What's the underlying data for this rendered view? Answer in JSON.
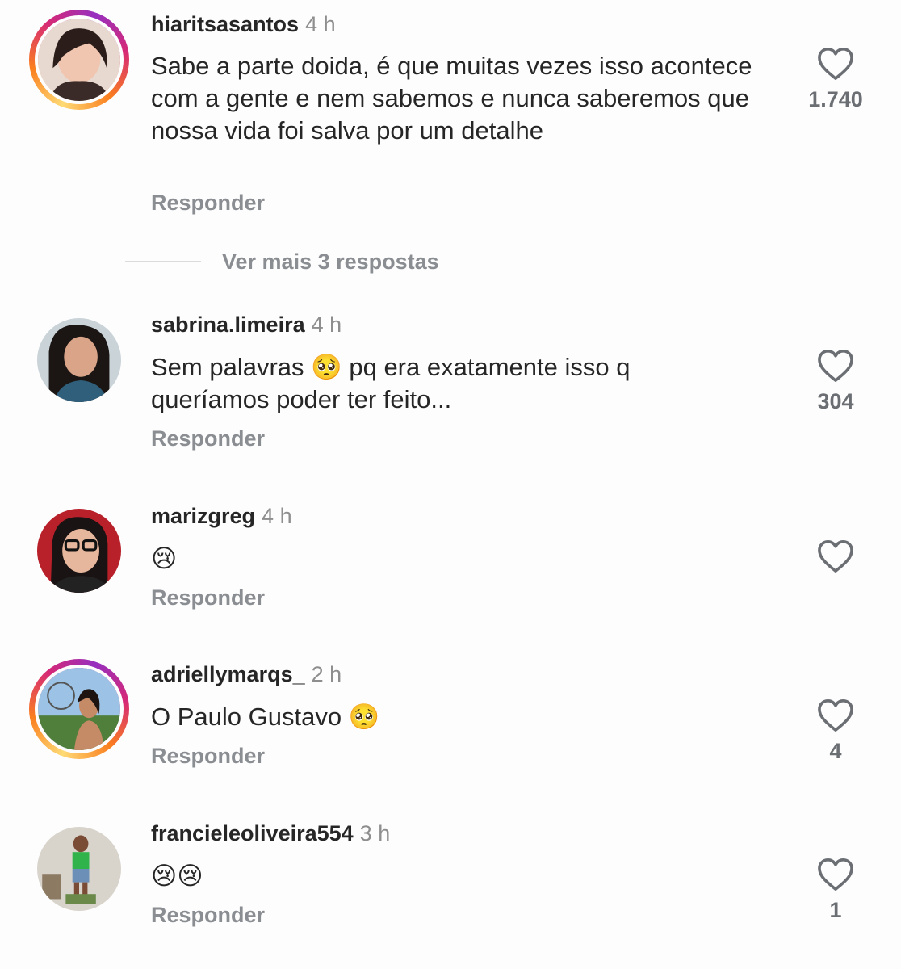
{
  "comments": [
    {
      "username": "hiaritsasantos",
      "time": "4 h",
      "text": "Sabe a parte doida, é que muitas vezes isso acontece com a gente e nem sabemos e nunca saberemos que nossa vida foi salva por um detalhe",
      "reply_label": "Responder",
      "likes": "1.740",
      "story_ring": true
    },
    {
      "username": "sabrina.limeira",
      "time": "4 h",
      "text": "Sem palavras 🥺 pq era exatamente isso q queríamos poder ter feito...",
      "reply_label": "Responder",
      "likes": "304",
      "story_ring": false
    },
    {
      "username": "marizgreg",
      "time": "4 h",
      "text": "😢",
      "reply_label": "Responder",
      "likes": "",
      "story_ring": false
    },
    {
      "username": "adriellymarqs_",
      "time": "2 h",
      "text": "O Paulo Gustavo 🥺",
      "reply_label": "Responder",
      "likes": "4",
      "story_ring": true
    },
    {
      "username": "francieleoliveira554",
      "time": "3 h",
      "text": "😢😢",
      "reply_label": "Responder",
      "likes": "1",
      "story_ring": false
    }
  ],
  "more_replies_label": "Ver mais 3 respostas",
  "colors": {
    "text": "#262626",
    "muted": "#8e8e8e",
    "ring_gradient": [
      "#feda75",
      "#fa7e1e",
      "#d62976",
      "#962fbf"
    ]
  }
}
